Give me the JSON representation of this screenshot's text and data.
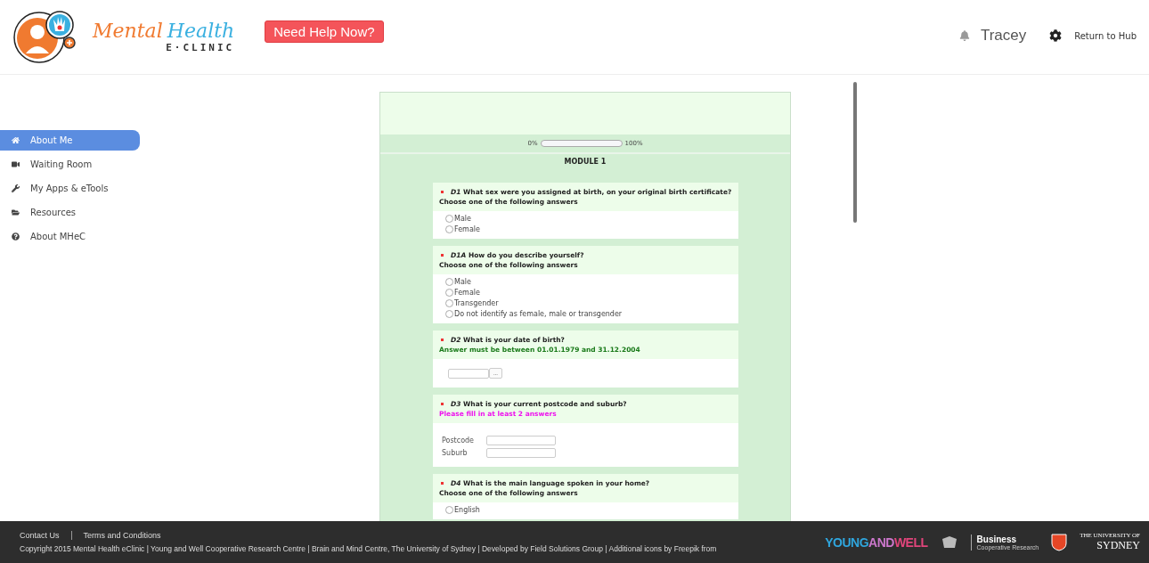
{
  "header": {
    "logo": {
      "word_1": "Mental",
      "word_2": "Health",
      "subtitle": "E·CLINIC"
    },
    "help_button": "Need Help Now?",
    "user": "Tracey",
    "return_link": "Return to Hub"
  },
  "sidebar": {
    "items": [
      {
        "label": "About Me",
        "selected": true
      },
      {
        "label": "Waiting Room",
        "selected": false
      },
      {
        "label": "My Apps & eTools",
        "selected": false
      },
      {
        "label": "Resources",
        "selected": false
      },
      {
        "label": "About MHeC",
        "selected": false
      }
    ]
  },
  "survey": {
    "progress": {
      "start": "0%",
      "end": "100%",
      "level": 0
    },
    "module": "MODULE 1",
    "questions": [
      {
        "kind": "radio",
        "code": "D1",
        "text": "What sex were you assigned at birth, on your original birth certificate?",
        "hint": "Choose one of the following answers",
        "color": "#222222",
        "options": [
          {
            "label": "Male",
            "selected": false
          },
          {
            "label": "Female",
            "selected": false
          }
        ]
      },
      {
        "kind": "radio",
        "code": "D1A",
        "text": "How do you describe yourself?",
        "hint": "Choose one of the following answers",
        "color": "#222222",
        "options": [
          {
            "label": "Male",
            "selected": false
          },
          {
            "label": "Female",
            "selected": false
          },
          {
            "label": "Transgender",
            "selected": false
          },
          {
            "label": "Do not identify as female, male or transgender",
            "selected": false
          }
        ]
      },
      {
        "kind": "date",
        "code": "D2",
        "text": "What is your date of birth?",
        "hint": "Answer must be between 01.01.1979 and 31.12.2004",
        "color": "#1a7a1a",
        "picker": "..."
      },
      {
        "kind": "fields",
        "code": "D3",
        "text": "What is your current postcode and suburb?",
        "hint": "Please fill in at least 2 answers",
        "color": "#ee11ee",
        "fields": [
          {
            "label": "Postcode"
          },
          {
            "label": "Suburb"
          }
        ]
      },
      {
        "kind": "radio",
        "code": "D4",
        "text": "What is the main language spoken in your home?",
        "hint": "Choose one of the following answers",
        "color": "#222222",
        "options": [
          {
            "label": "English",
            "selected": false
          }
        ]
      }
    ]
  },
  "footer": {
    "links": [
      "Contact Us",
      "Terms and Conditions"
    ],
    "copyright": "Copyright 2015 Mental Health eClinic | Young and Well Cooperative Research Centre | Brain and Mind Centre, The University of Sydney | Developed by Field Solutions Group | Additional icons by Freepik from",
    "partner_1": [
      "YOUNG",
      "AND",
      "WELL"
    ],
    "partner_2": {
      "title": "Business",
      "subtitle": "Cooperative Research"
    },
    "partner_3": {
      "top": "THE UNIVERSITY OF",
      "name": "SYDNEY"
    }
  }
}
